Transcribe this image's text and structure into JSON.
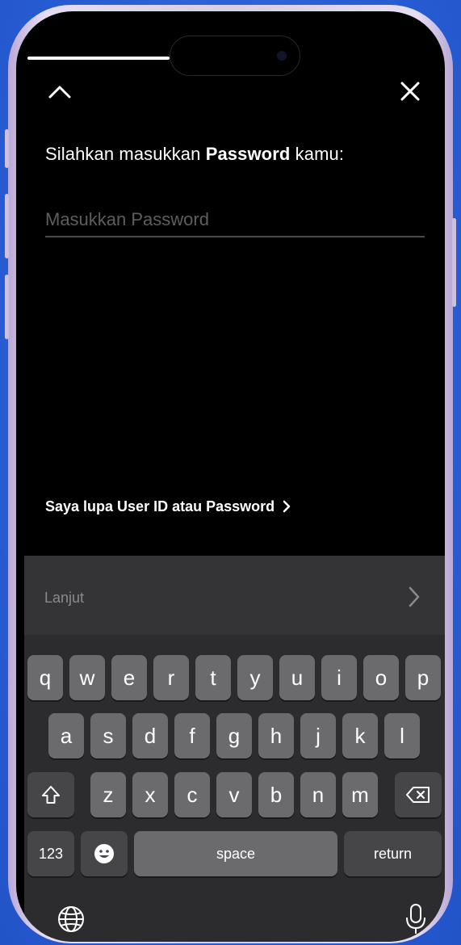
{
  "header": {
    "collapse_icon": "chevron-up-icon",
    "close_icon": "close-icon"
  },
  "prompt": {
    "text_before": "Silahkan masukkan ",
    "text_bold": "Password",
    "text_after": " kamu:"
  },
  "password_field": {
    "placeholder": "Masukkan Password",
    "value": ""
  },
  "forgot_link": {
    "label": "Saya lupa User ID atau Password"
  },
  "suggest_bar": {
    "label": "Lanjut"
  },
  "keyboard": {
    "row1": [
      "q",
      "w",
      "e",
      "r",
      "t",
      "y",
      "u",
      "i",
      "o",
      "p"
    ],
    "row2": [
      "a",
      "s",
      "d",
      "f",
      "g",
      "h",
      "j",
      "k",
      "l"
    ],
    "row3": [
      "z",
      "x",
      "c",
      "v",
      "b",
      "n",
      "m"
    ],
    "numbers_label": "123",
    "space_label": "space",
    "return_label": "return",
    "shift_icon": "shift-icon",
    "delete_icon": "backspace-icon",
    "emoji_icon": "emoji-icon",
    "globe_icon": "globe-icon",
    "mic_icon": "microphone-icon"
  },
  "colors": {
    "background": "#2f63d8",
    "screen": "#000000",
    "keyboard": "#2c2c2e",
    "key": "#6b6b6e",
    "key_dark": "#464648"
  }
}
